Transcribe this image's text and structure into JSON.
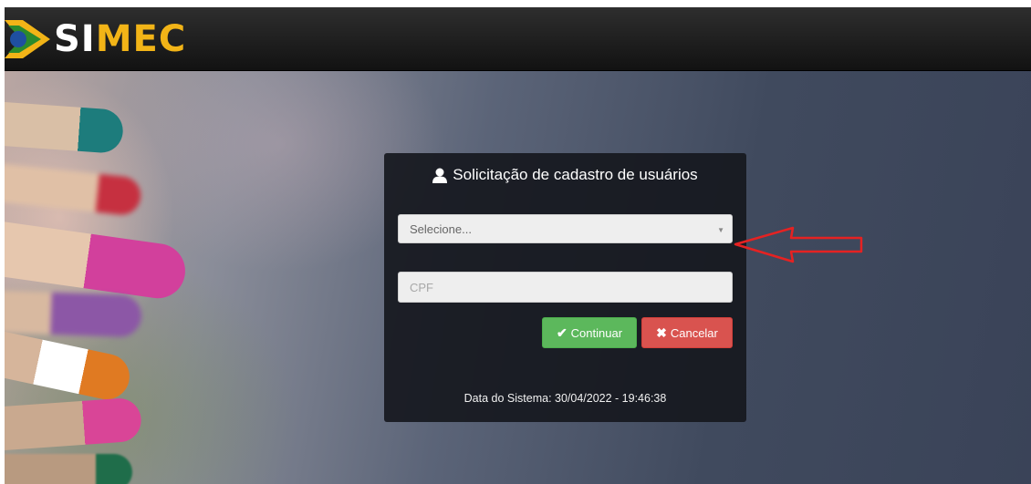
{
  "header": {
    "logo_text_si": "SI",
    "logo_text_mec": "MEC",
    "logo_colors": {
      "blue": "#1f4fa0",
      "yellow": "#f2b417",
      "green": "#2c8a2c"
    }
  },
  "panel": {
    "title": "Solicitação de cadastro de usuários",
    "title_icon": "user-icon",
    "select_value": "Selecione...",
    "cpf_placeholder": "CPF",
    "continue_label": "Continuar",
    "continue_icon": "check-icon",
    "cancel_label": "Cancelar",
    "cancel_icon": "x-icon",
    "system_date": "Data do Sistema: 30/04/2022 - 19:46:38"
  },
  "annotation": {
    "type": "arrow",
    "color": "#e52222"
  }
}
